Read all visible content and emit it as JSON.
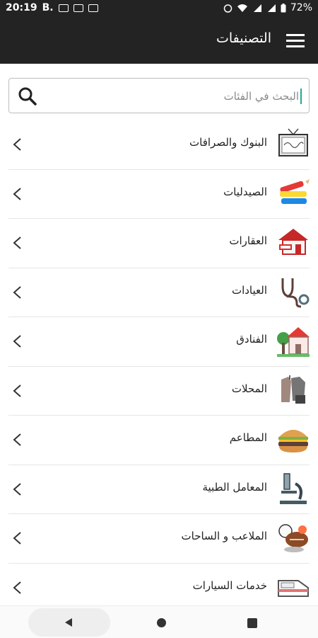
{
  "status_bar": {
    "time": "20:19",
    "carrier": "B.",
    "battery": "72%"
  },
  "appbar": {
    "title": "التصنيفات",
    "menu_icon": "hamburger-menu-icon"
  },
  "search": {
    "placeholder": "البحث في الفئات",
    "value": "",
    "icon": "search-icon"
  },
  "categories": [
    {
      "label": "البنوك والصرافات",
      "icon": "bank-sign-icon"
    },
    {
      "label": "الصيدليات",
      "icon": "pharmacy-icon"
    },
    {
      "label": "العقارات",
      "icon": "house-for-sale-icon"
    },
    {
      "label": "العيادات",
      "icon": "stethoscope-icon"
    },
    {
      "label": "الفنادق",
      "icon": "hotel-icon"
    },
    {
      "label": "المحلات",
      "icon": "clothes-shop-icon"
    },
    {
      "label": "المطاعم",
      "icon": "burger-icon"
    },
    {
      "label": "المعامل الطبية",
      "icon": "microscope-icon"
    },
    {
      "label": "الملاعب و الساحات",
      "icon": "sports-balls-icon"
    },
    {
      "label": "خدمات السيارات",
      "icon": "car-icon"
    }
  ],
  "colors": {
    "appbar": "#232323",
    "accent": "#26a69a"
  }
}
